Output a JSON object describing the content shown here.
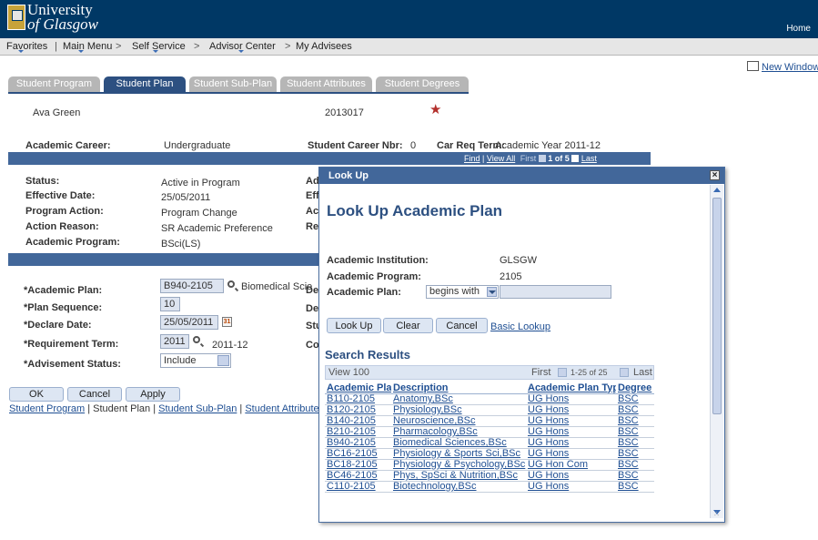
{
  "header": {
    "university_line1": "University",
    "university_line2": "of Glasgow",
    "home_link": "Home"
  },
  "menubar": {
    "items": [
      "Favorites",
      "Main Menu",
      "Self Service",
      "Advisor Center",
      "My Advisees"
    ],
    "separator": ">"
  },
  "new_window": "New Window",
  "tabs": [
    "Student Program",
    "Student Plan",
    "Student Sub-Plan",
    "Student Attributes",
    "Student Degrees"
  ],
  "active_tab": "Student Plan",
  "student": {
    "name": "Ava Green",
    "id": "2013017",
    "flag_symbol": "★"
  },
  "career": {
    "academic_career_label": "Academic Career:",
    "academic_career_value": "Undergraduate",
    "career_nbr_label": "Student Career Nbr:",
    "career_nbr_value": "0",
    "car_req_term_label": "Car Req Term:",
    "car_req_term_value": "Academic Year 2011-12"
  },
  "band_nav": {
    "find": "Find",
    "view_all": "View All",
    "first": "First",
    "page_of": "1 of 5",
    "last": "Last"
  },
  "program": {
    "status_label": "Status:",
    "status_value": "Active in Program",
    "effective_date_label": "Effective Date:",
    "effective_date_value": "25/05/2011",
    "program_action_label": "Program Action:",
    "program_action_value": "Program Change",
    "action_reason_label": "Action Reason:",
    "action_reason_value": "SR Academic Preference",
    "academic_program_label": "Academic Program:",
    "academic_program_value": "BSci(LS)",
    "partial_labels": [
      "Ad",
      "Eff",
      "Act",
      "Re"
    ]
  },
  "plan": {
    "academic_plan_label": "*Academic Plan:",
    "academic_plan_value": "B940-2105",
    "academic_plan_desc": "Biomedical Scie",
    "plan_sequence_label": "*Plan Sequence:",
    "plan_sequence_value": "10",
    "declare_date_label": "*Declare Date:",
    "declare_date_value": "25/05/2011",
    "requirement_term_label": "*Requirement Term:",
    "requirement_term_value": "2011",
    "requirement_term_desc": "2011-12",
    "advisement_status_label": "*Advisement Status:",
    "advisement_status_value": "Include",
    "partial_labels": [
      "De",
      "De",
      "Stu",
      "Co"
    ]
  },
  "buttons": {
    "ok": "OK",
    "cancel": "Cancel",
    "apply": "Apply"
  },
  "bottom_links": {
    "student_program": "Student Program",
    "student_plan": "Student Plan",
    "student_sub_plan": "Student Sub-Plan",
    "student_attributes": "Student Attributes",
    "sep": "|"
  },
  "modal": {
    "title": "Look Up",
    "close": "×",
    "heading": "Look Up Academic Plan",
    "institution_label": "Academic Institution:",
    "institution_value": "GLSGW",
    "program_label": "Academic Program:",
    "program_value": "2105",
    "plan_label": "Academic Plan:",
    "plan_operator": "begins with",
    "plan_input_value": "",
    "lookup_btn": "Look Up",
    "clear_btn": "Clear",
    "cancel_btn": "Cancel",
    "basic_lookup": "Basic Lookup",
    "search_results": "Search Results",
    "view_100": "View 100",
    "first": "First",
    "range": "1-25 of 25",
    "last": "Last",
    "columns": [
      "Academic Plan",
      "Description",
      "Academic Plan Type",
      "Degree"
    ],
    "rows": [
      [
        "B110-2105",
        "Anatomy,BSc",
        "UG Hons",
        "BSC"
      ],
      [
        "B120-2105",
        "Physiology,BSc",
        "UG Hons",
        "BSC"
      ],
      [
        "B140-2105",
        "Neuroscience,BSc",
        "UG Hons",
        "BSC"
      ],
      [
        "B210-2105",
        "Pharmacology,BSc",
        "UG Hons",
        "BSC"
      ],
      [
        "B940-2105",
        "Biomedical Sciences,BSc",
        "UG Hons",
        "BSC"
      ],
      [
        "BC16-2105",
        "Physiology & Sports Sci,BSc",
        "UG Hons",
        "BSC"
      ],
      [
        "BC18-2105",
        "Physiology & Psychology,BSc",
        "UG Hon Com",
        "BSC"
      ],
      [
        "BC46-2105",
        "Phys, SpSci & Nutrition,BSc",
        "UG Hons",
        "BSC"
      ],
      [
        "C110-2105",
        "Biotechnology,BSc",
        "UG Hons",
        "BSC"
      ]
    ]
  }
}
